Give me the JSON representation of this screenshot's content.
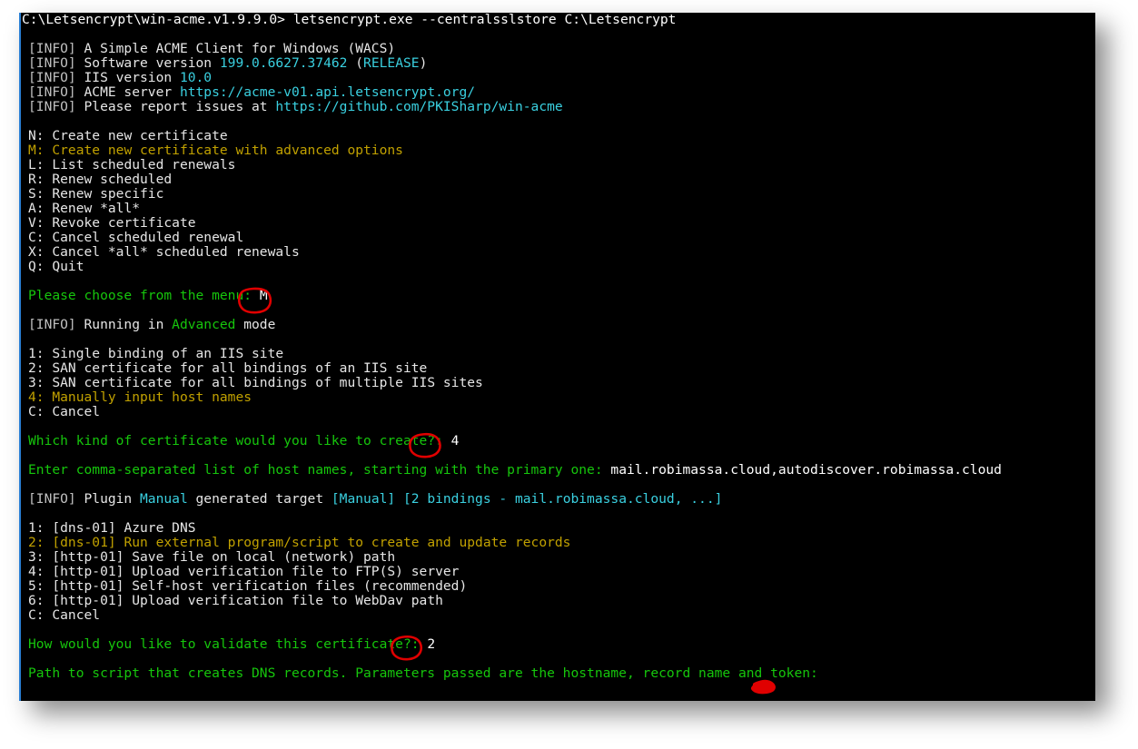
{
  "window": {
    "title_line": "C:\\Letsencrypt\\win-acme.v1.9.9.0> letsencrypt.exe --centralsslstore C:\\Letsencrypt",
    "background_color": "#000000",
    "border_color": "#2a7fd4",
    "text_color": "#cccccc"
  },
  "colors": {
    "green": "#16c60c",
    "yellow": "#c1a100",
    "cyan": "#3ad0e0",
    "white": "#e6e6e6",
    "annotation_red": "#e00000"
  },
  "terminal": {
    "info_lines": [
      {
        "tag": "[INFO]",
        "parts": [
          {
            "text": " A Simple ACME Client for Windows (WACS)",
            "color": "white"
          }
        ]
      },
      {
        "tag": "[INFO]",
        "parts": [
          {
            "text": " Software version ",
            "color": "white"
          },
          {
            "text": "199.0.6627.37462",
            "color": "cyan"
          },
          {
            "text": " (",
            "color": "white"
          },
          {
            "text": "RELEASE",
            "color": "cyan"
          },
          {
            "text": ")",
            "color": "white"
          }
        ]
      },
      {
        "tag": "[INFO]",
        "parts": [
          {
            "text": " IIS version ",
            "color": "white"
          },
          {
            "text": "10.0",
            "color": "cyan"
          }
        ]
      },
      {
        "tag": "[INFO]",
        "parts": [
          {
            "text": " ACME server ",
            "color": "white"
          },
          {
            "text": "https://acme-v01.api.letsencrypt.org/",
            "color": "cyan"
          }
        ]
      },
      {
        "tag": "[INFO]",
        "parts": [
          {
            "text": " Please report issues at ",
            "color": "white"
          },
          {
            "text": "https://github.com/PKISharp/win-acme",
            "color": "cyan"
          }
        ]
      }
    ],
    "main_menu": [
      {
        "key": "N:",
        "label": " Create new certificate",
        "color": "white"
      },
      {
        "key": "M:",
        "label": " Create new certificate with advanced options",
        "color": "yellow"
      },
      {
        "key": "L:",
        "label": " List scheduled renewals",
        "color": "white"
      },
      {
        "key": "R:",
        "label": " Renew scheduled",
        "color": "white"
      },
      {
        "key": "S:",
        "label": " Renew specific",
        "color": "white"
      },
      {
        "key": "A:",
        "label": " Renew *all*",
        "color": "white"
      },
      {
        "key": "V:",
        "label": " Revoke certificate",
        "color": "white"
      },
      {
        "key": "C:",
        "label": " Cancel scheduled renewal",
        "color": "white"
      },
      {
        "key": "X:",
        "label": " Cancel *all* scheduled renewals",
        "color": "white"
      },
      {
        "key": "Q:",
        "label": " Quit",
        "color": "white"
      }
    ],
    "menu_prompt": {
      "prompt": "Please choose from the menu: ",
      "answer": "M",
      "annotated": true
    },
    "advanced_mode_line": {
      "tag": "[INFO]",
      "before": " Running in ",
      "highlight": "Advanced",
      "after": " mode"
    },
    "cert_type_menu": [
      {
        "key": "1:",
        "label": " Single binding of an IIS site",
        "color": "white"
      },
      {
        "key": "2:",
        "label": " SAN certificate for all bindings of an IIS site",
        "color": "white"
      },
      {
        "key": "3:",
        "label": " SAN certificate for all bindings of multiple IIS sites",
        "color": "white"
      },
      {
        "key": "4:",
        "label": " Manually input host names",
        "color": "yellow"
      },
      {
        "key": "C:",
        "label": " Cancel",
        "color": "white"
      }
    ],
    "cert_type_prompt": {
      "prompt": "Which kind of certificate would you like to create?: ",
      "answer": "4",
      "annotated": true
    },
    "hostnames_prompt": {
      "prompt": "Enter comma-separated list of host names, starting with the primary one: ",
      "answer": "mail.robimassa.cloud,autodiscover.robimassa.cloud"
    },
    "plugin_line": {
      "tag": "[INFO]",
      "before": " Plugin ",
      "plugin_name": "Manual",
      "middle": " generated target ",
      "target": "[Manual] [2 bindings - mail.robimassa.cloud, ...]"
    },
    "validation_menu": [
      {
        "key": "1:",
        "label": " [dns-01] Azure DNS",
        "color": "white"
      },
      {
        "key": "2:",
        "label": " [dns-01] Run external program/script to create and update records",
        "color": "yellow"
      },
      {
        "key": "3:",
        "label": " [http-01] Save file on local (network) path",
        "color": "white"
      },
      {
        "key": "4:",
        "label": " [http-01] Upload verification file to FTP(S) server",
        "color": "white"
      },
      {
        "key": "5:",
        "label": " [http-01] Self-host verification files (recommended)",
        "color": "white"
      },
      {
        "key": "6:",
        "label": " [http-01] Upload verification file to WebDav path",
        "color": "white"
      },
      {
        "key": "C:",
        "label": " Cancel",
        "color": "white"
      }
    ],
    "validation_prompt": {
      "prompt": "How would you like to validate this certificate?: ",
      "answer": "2",
      "annotated": true
    },
    "script_path_prompt": {
      "prompt": "Path to script that creates DNS records. Parameters passed are the hostname, record name and token: ",
      "answer": ""
    }
  },
  "annotations": {
    "circle_m": {
      "target": "M",
      "shape": "hand-drawn-circle",
      "color": "#e00000"
    },
    "circle_4": {
      "target": "4",
      "shape": "hand-drawn-circle",
      "color": "#e00000"
    },
    "circle_2": {
      "target": "2",
      "shape": "hand-drawn-circle",
      "color": "#e00000"
    },
    "scribble_cursor": {
      "shape": "hand-drawn-scribble",
      "color": "#e00000"
    }
  }
}
